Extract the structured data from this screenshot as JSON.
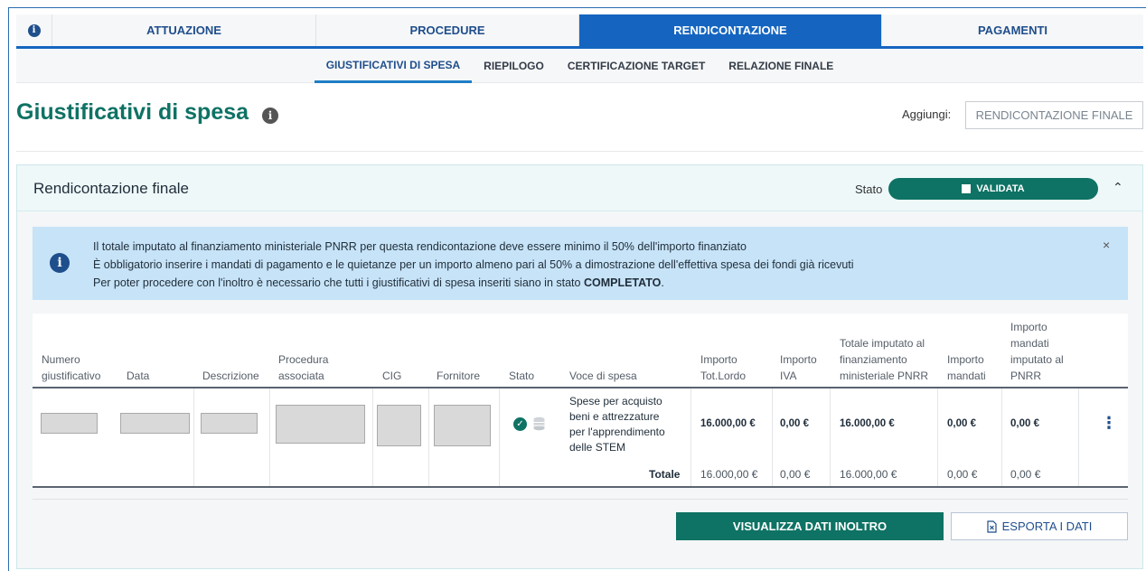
{
  "tabs": {
    "info_icon": "info-icon",
    "items": [
      "ATTUAZIONE",
      "PROCEDURE",
      "RENDICONTAZIONE",
      "PAGAMENTI"
    ],
    "active": "RENDICONTAZIONE"
  },
  "subtabs": {
    "items": [
      "GIUSTIFICATIVI DI SPESA",
      "RIEPILOGO",
      "CERTIFICAZIONE TARGET",
      "RELAZIONE FINALE"
    ],
    "active": "GIUSTIFICATIVI DI SPESA"
  },
  "page": {
    "title": "Giustificativi di spesa",
    "add_label": "Aggiungi:",
    "add_value": "RENDICONTAZIONE FINALE"
  },
  "panel": {
    "title": "Rendicontazione finale",
    "stato_label": "Stato",
    "stato_value": "VALIDATA",
    "alert": {
      "line1": "Il totale imputato al finanziamento ministeriale PNRR per questa rendicontazione deve essere minimo il 50% dell'importo finanziato",
      "line2": "È obbligatorio inserire i mandati di pagamento e le quietanze per un importo almeno pari al 50% a dimostrazione dell'effettiva spesa dei fondi già ricevuti",
      "line3_prefix": "Per poter procedere con l'inoltro è necessario che tutti i giustificativi di spesa inseriti siano in stato ",
      "line3_bold": "COMPLETATO",
      "line3_suffix": ".",
      "close": "×"
    }
  },
  "table": {
    "headers": {
      "numero_1": "Numero",
      "numero_2": "giustificativo",
      "data": "Data",
      "descrizione": "Descrizione",
      "procedura_1": "Procedura",
      "procedura_2": "associata",
      "cig": "CIG",
      "fornitore": "Fornitore",
      "stato": "Stato",
      "voce": "Voce di spesa",
      "lordo_1": "Importo",
      "lordo_2": "Tot.Lordo",
      "iva_1": "Importo",
      "iva_2": "IVA",
      "totale_1": "Totale imputato al",
      "totale_2": "finanziamento",
      "totale_3": "ministeriale PNRR",
      "mandati_1": "Importo",
      "mandati_2": "mandati",
      "pnrr_1": "Importo",
      "pnrr_2": "mandati",
      "pnrr_3": "imputato al",
      "pnrr_4": "PNRR"
    },
    "row": {
      "voce_1": "Spese per acquisto",
      "voce_2": "beni e attrezzature",
      "voce_3": "per l'apprendimento",
      "voce_4": "delle STEM",
      "lordo": "16.000,00 €",
      "iva": "0,00 €",
      "totale": "16.000,00 €",
      "mandati": "0,00 €",
      "pnrr": "0,00 €"
    },
    "totals": {
      "label": "Totale",
      "lordo": "16.000,00 €",
      "iva": "0,00 €",
      "totale": "16.000,00 €",
      "mandati": "0,00 €",
      "pnrr": "0,00 €"
    }
  },
  "actions": {
    "primary": "VISUALIZZA DATI INOLTRO",
    "secondary": "ESPORTA I DATI"
  },
  "colors": {
    "teal": "#0e7264",
    "blue": "#1565c0",
    "alert_bg": "#c7e3f7"
  }
}
